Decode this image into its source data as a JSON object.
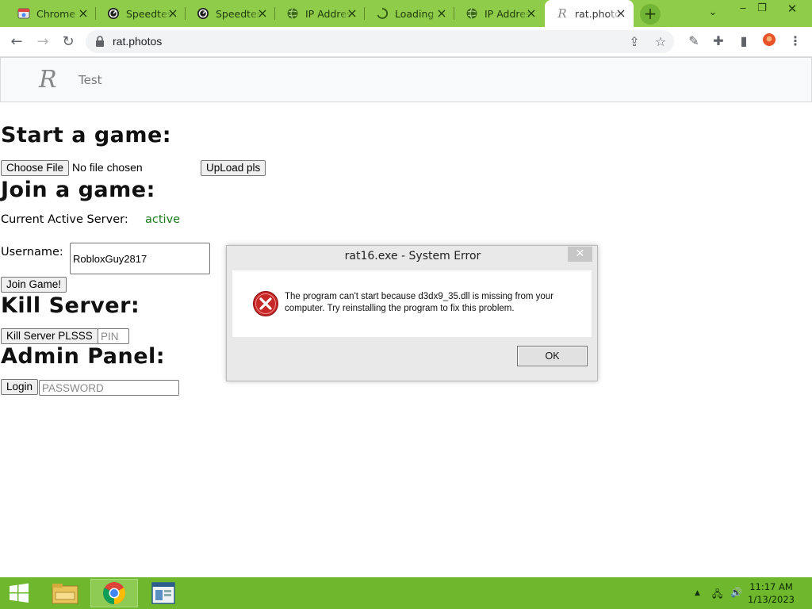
{
  "browser": {
    "tabs": [
      {
        "title": "Chrome",
        "icon": "chrome-settings-icon",
        "active": false
      },
      {
        "title": "Speedtest",
        "icon": "speedtest-icon",
        "active": false
      },
      {
        "title": "Speedtest",
        "icon": "speedtest-icon",
        "active": false
      },
      {
        "title": "IP Address",
        "icon": "globe-icon",
        "active": false
      },
      {
        "title": "Loading",
        "icon": "loading-spinner-icon",
        "active": false
      },
      {
        "title": "IP Address",
        "icon": "globe-icon",
        "active": false
      },
      {
        "title": "rat.photos",
        "icon": "rat-photos-favicon",
        "active": true
      }
    ],
    "url": "rat.photos",
    "theme_color": "#8fcc4a"
  },
  "site": {
    "logo_letter": "R",
    "nav_link": "Test"
  },
  "page": {
    "start_heading": "Start a game:",
    "choose_file_label": "Choose File",
    "no_file_text": "No file chosen",
    "upload_label": "UpLoad pls",
    "join_heading": "Join a game:",
    "server_label": "Current Active Server:",
    "server_status": "active",
    "username_label": "Username:",
    "username_value": "RobloxGuy2817",
    "join_button": "Join Game!",
    "kill_heading": "Kill Server:",
    "kill_button": "Kill Server PLSSS",
    "pin_placeholder": "PIN",
    "admin_heading": "Admin Panel:",
    "login_button": "Login",
    "password_placeholder": "PASSWORD"
  },
  "dialog": {
    "title": "rat16.exe - System Error",
    "message": "The program can't start because d3dx9_35.dll is missing from your computer. Try reinstalling the program to fix this problem.",
    "ok_label": "OK",
    "icon": "error-icon"
  },
  "taskbar": {
    "time": "11:17 AM",
    "date": "1/13/2023",
    "color": "#6fb82e"
  }
}
